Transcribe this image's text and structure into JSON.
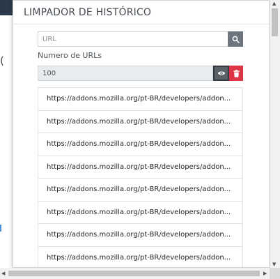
{
  "background": {
    "fragment_text": "("
  },
  "popup": {
    "title": "LIMPADOR DE HISTÓRICO",
    "search": {
      "placeholder": "URL",
      "value": "",
      "icon": "search-icon"
    },
    "count": {
      "label": "Numero de URLs",
      "value": "100",
      "view_icon": "eye-icon",
      "delete_icon": "trash-icon"
    },
    "urls": [
      "https://addons.mozilla.org/pt-BR/developers/addon...",
      "https://addons.mozilla.org/pt-BR/developers/addon...",
      "https://addons.mozilla.org/pt-BR/developers/addon...",
      "https://addons.mozilla.org/pt-BR/developers/addon...",
      "https://addons.mozilla.org/pt-BR/developers/addon...",
      "https://addons.mozilla.org/pt-BR/developers/addon...",
      "https://addons.mozilla.org/pt-BR/developers/addon...",
      "https://addons.mozilla.org/pt-BR/developers/addon..."
    ]
  },
  "colors": {
    "search_button": "#6c757d",
    "view_button": "#5a6268",
    "delete_button": "#dc3545",
    "count_bg": "#e9ecef"
  }
}
